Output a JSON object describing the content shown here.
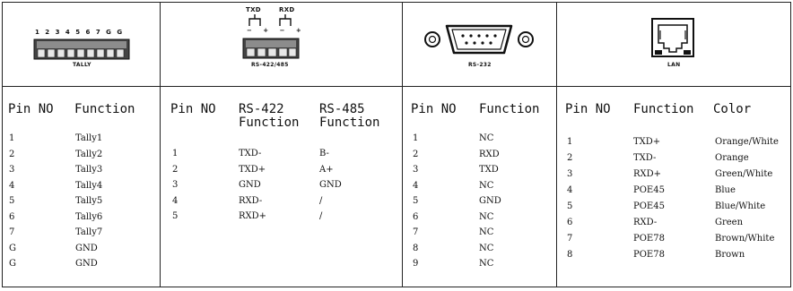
{
  "tally": {
    "caption": "TALLY",
    "pin_labels": "1 2 3 4 5 6 7 G G",
    "headers": [
      "Pin NO",
      "Function"
    ],
    "rows": [
      [
        "1",
        "Tally1"
      ],
      [
        "2",
        "Tally2"
      ],
      [
        "3",
        "Tally3"
      ],
      [
        "4",
        "Tally4"
      ],
      [
        "5",
        "Tally5"
      ],
      [
        "6",
        "Tally6"
      ],
      [
        "7",
        "Tally7"
      ],
      [
        "G",
        "GND"
      ],
      [
        "G",
        "GND"
      ]
    ]
  },
  "rs422": {
    "caption": "RS-422/485",
    "txd_label": "TXD",
    "rxd_label": "RXD",
    "pol_labels": "− + − +",
    "headers": [
      "Pin NO",
      "RS-422 Function",
      "RS-485 Function"
    ],
    "rows": [
      [
        "1",
        "TXD-",
        "B-"
      ],
      [
        "2",
        "TXD+",
        "A+"
      ],
      [
        "3",
        "GND",
        "GND"
      ],
      [
        "4",
        "RXD-",
        "/"
      ],
      [
        "5",
        "RXD+",
        "/"
      ]
    ]
  },
  "rs232": {
    "caption": "RS-232",
    "headers": [
      "Pin NO",
      "Function"
    ],
    "rows": [
      [
        "1",
        "NC"
      ],
      [
        "2",
        "RXD"
      ],
      [
        "3",
        "TXD"
      ],
      [
        "4",
        "NC"
      ],
      [
        "5",
        "GND"
      ],
      [
        "6",
        "NC"
      ],
      [
        "7",
        "NC"
      ],
      [
        "8",
        "NC"
      ],
      [
        "9",
        "NC"
      ]
    ]
  },
  "lan": {
    "caption": "LAN",
    "headers": [
      "Pin NO",
      "Function",
      "Color"
    ],
    "rows": [
      [
        "1",
        "TXD+",
        "Orange/White"
      ],
      [
        "2",
        "TXD-",
        "Orange"
      ],
      [
        "3",
        "RXD+",
        "Green/White"
      ],
      [
        "4",
        "POE45",
        "Blue"
      ],
      [
        "5",
        "POE45",
        "Blue/White"
      ],
      [
        "6",
        "RXD-",
        "Green"
      ],
      [
        "7",
        "POE78",
        "Brown/White"
      ],
      [
        "8",
        "POE78",
        "Brown"
      ]
    ]
  }
}
